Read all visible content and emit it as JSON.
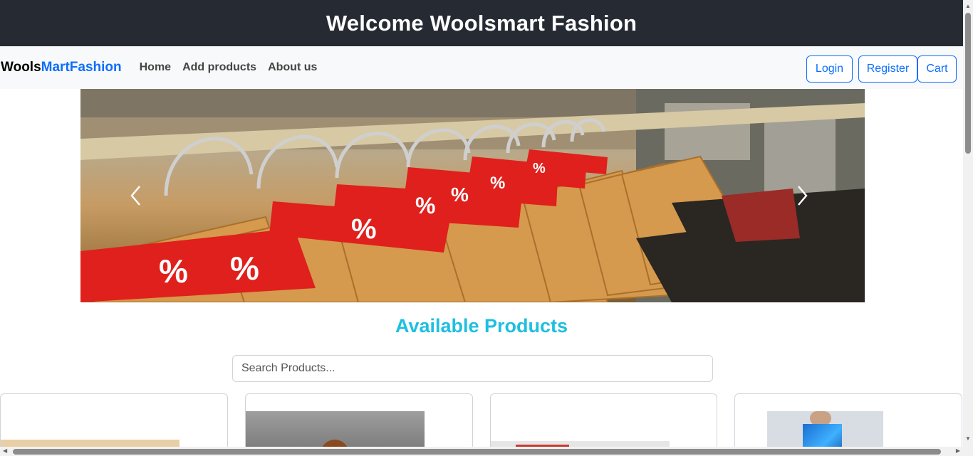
{
  "header": {
    "title": "Welcome Woolsmart Fashion"
  },
  "navbar": {
    "brand_part1": "Wools",
    "brand_part2": "MartFashion",
    "links": [
      {
        "label": "Home"
      },
      {
        "label": "Add products"
      },
      {
        "label": "About us"
      }
    ],
    "buttons": {
      "login": "Login",
      "register": "Register",
      "cart": "Cart"
    }
  },
  "carousel": {
    "slide": "clothes-hangers-with-percent-sale-tags",
    "tag_text": "%",
    "prev_icon": "chevron-left-icon",
    "next_icon": "chevron-right-icon"
  },
  "products": {
    "title": "Available Products",
    "search_placeholder": "Search Products...",
    "cards": [
      {
        "image": "product-image-1"
      },
      {
        "image": "product-image-2"
      },
      {
        "image": "product-image-3"
      },
      {
        "image": "product-image-4"
      }
    ]
  },
  "colors": {
    "banner_bg": "#262a33",
    "accent": "#0d6efd",
    "section_title": "#1ebfe0",
    "sale_tag": "#e0201c"
  }
}
